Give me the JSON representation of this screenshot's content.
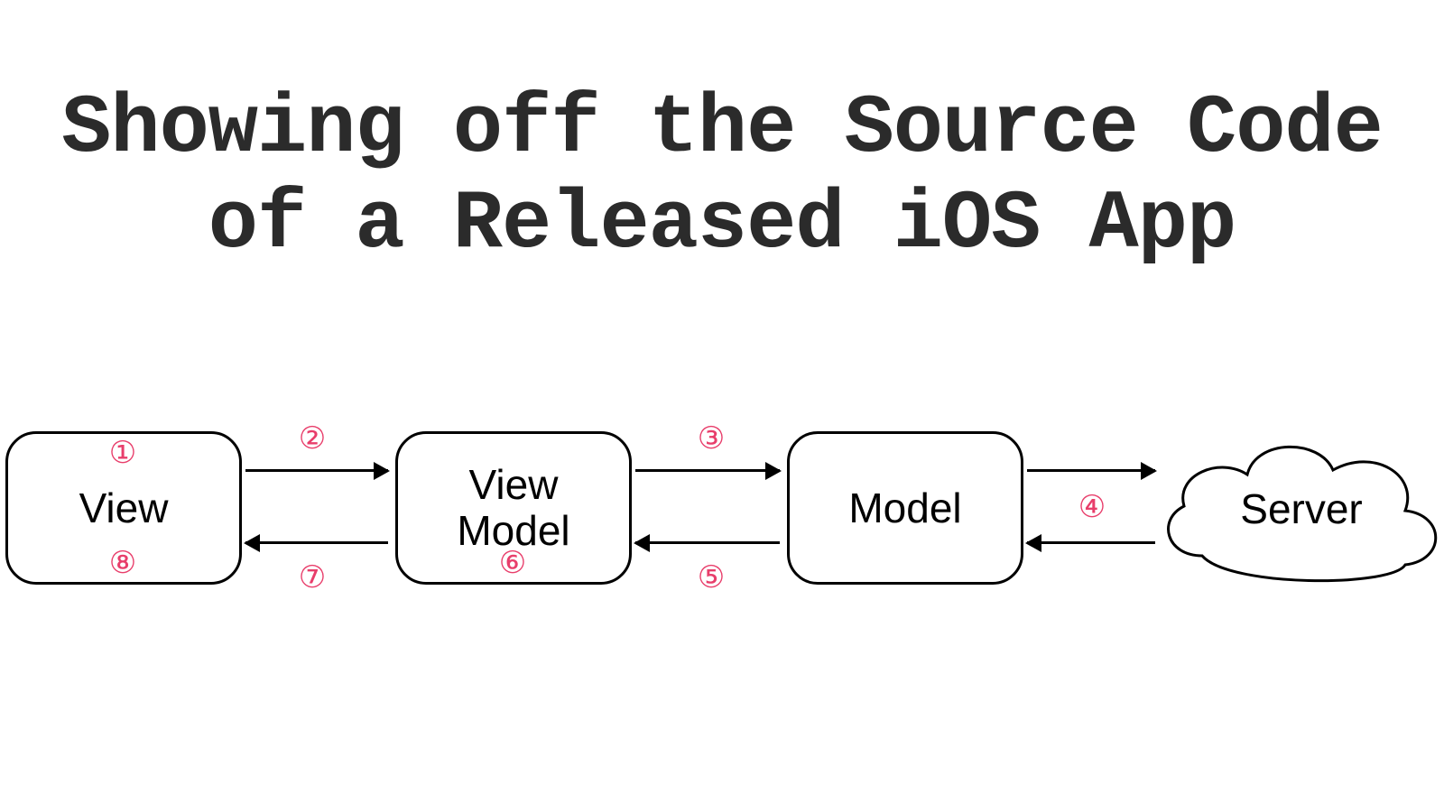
{
  "title": "Showing off the Source Code\nof a Released iOS App",
  "nodes": {
    "view": "View",
    "viewModel": "View\nModel",
    "model": "Model",
    "server": "Server"
  },
  "badges": {
    "b1": "①",
    "b2": "②",
    "b3": "③",
    "b4": "④",
    "b5": "⑤",
    "b6": "⑥",
    "b7": "⑦",
    "b8": "⑧"
  },
  "colors": {
    "badge": "#e83e6b",
    "text": "#2b2b2b"
  }
}
